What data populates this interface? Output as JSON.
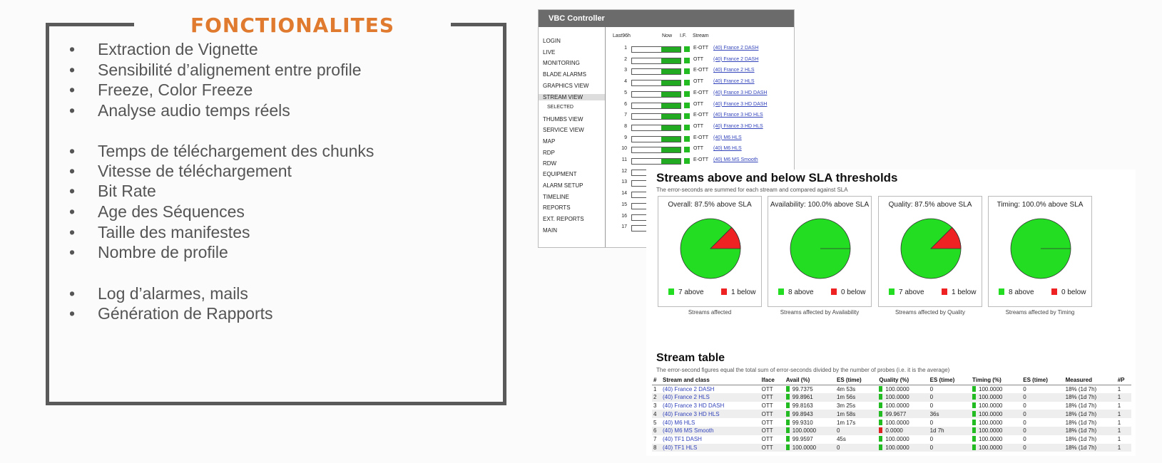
{
  "features": {
    "title": "FONCTIONALITES",
    "items": [
      "Extraction de Vignette",
      "Sensibilité d’alignement entre profile",
      " Freeze, Color Freeze",
      " Analyse audio temps réels",
      " Temps de téléchargement des chunks",
      " Vitesse de téléchargement",
      " Bit Rate",
      " Age des Séquences",
      " Taille des manifestes",
      " Nombre de profile",
      " Log d’alarmes, mails",
      " Génération de Rapports"
    ],
    "bullet": "•"
  },
  "vbc": {
    "title": "VBC Controller",
    "headers": {
      "last96h": "Last96h",
      "now": "Now",
      "if": "I.F.",
      "stream": "Stream"
    },
    "menu": [
      "LOGIN",
      "LIVE",
      "MONITORING",
      "BLADE ALARMS",
      "GRAPHICS VIEW",
      "STREAM VIEW",
      "SELECTED",
      "THUMBS VIEW",
      "SERVICE VIEW",
      "MAP",
      "RDP",
      "RDW",
      "EQUIPMENT",
      "ALARM SETUP",
      "TIMELINE",
      "REPORTS",
      "EXT. REPORTS",
      "MAIN"
    ],
    "rows": [
      {
        "n": "1",
        "if": "E-OTT",
        "stream": "(40) France 2 DASH"
      },
      {
        "n": "2",
        "if": "OTT",
        "stream": "(40) France 2 DASH"
      },
      {
        "n": "3",
        "if": "E-OTT",
        "stream": "(40) France 2 HLS"
      },
      {
        "n": "4",
        "if": "OTT",
        "stream": "(40) France 2 HLS"
      },
      {
        "n": "5",
        "if": "E-OTT",
        "stream": "(40) France 3 HD DASH"
      },
      {
        "n": "6",
        "if": "OTT",
        "stream": "(40) France 3 HD DASH"
      },
      {
        "n": "7",
        "if": "E-OTT",
        "stream": "(40) France 3 HD HLS"
      },
      {
        "n": "8",
        "if": "OTT",
        "stream": "(40) France 3 HD HLS"
      },
      {
        "n": "9",
        "if": "E-OTT",
        "stream": "(40) M6 HLS"
      },
      {
        "n": "10",
        "if": "OTT",
        "stream": "(40) M6 HLS"
      },
      {
        "n": "11",
        "if": "E-OTT",
        "stream": "(40) M6 MS Smooth"
      },
      {
        "n": "12",
        "if": "",
        "stream": ""
      },
      {
        "n": "13",
        "if": "",
        "stream": ""
      },
      {
        "n": "14",
        "if": "",
        "stream": ""
      },
      {
        "n": "15",
        "if": "",
        "stream": ""
      },
      {
        "n": "16",
        "if": "",
        "stream": ""
      },
      {
        "n": "17",
        "if": "",
        "stream": ""
      }
    ]
  },
  "sla": {
    "title": "Streams above and below SLA thresholds",
    "subtitle": "The error-seconds are summed for each stream and compared against SLA",
    "colors": {
      "above": "#22dd22",
      "below": "#ee2222"
    },
    "pies": [
      {
        "title": "Overall: 87.5% above SLA",
        "above_label": "7 above",
        "below_label": "1 below",
        "above": 7,
        "below": 1,
        "caption": "Streams affected"
      },
      {
        "title": "Availability: 100.0% above SLA",
        "above_label": "8 above",
        "below_label": "0 below",
        "above": 8,
        "below": 0,
        "caption": "Streams affected by Availability"
      },
      {
        "title": "Quality: 87.5% above SLA",
        "above_label": "7 above",
        "below_label": "1 below",
        "above": 7,
        "below": 1,
        "caption": "Streams affected by Quality"
      },
      {
        "title": "Timing: 100.0% above SLA",
        "above_label": "8 above",
        "below_label": "0 below",
        "above": 8,
        "below": 0,
        "caption": "Streams affected by Timing"
      }
    ],
    "table_title": "Stream table",
    "table_subtitle": "The error-second figures equal the total sum of error-seconds divided by the number of probes (i.e. it is the average)",
    "columns": [
      "#",
      "Stream and class",
      "Iface",
      "Avail (%)",
      "ES (time)",
      "Quality (%)",
      "ES (time)",
      "Timing (%)",
      "ES (time)",
      "Measured",
      "#P"
    ],
    "rows": [
      [
        "1",
        "(40) France 2 DASH",
        "OTT",
        "99.7375",
        "4m 53s",
        "100.0000",
        "0",
        "100.0000",
        "0",
        "18% (1d 7h)",
        "1"
      ],
      [
        "2",
        "(40) France 2 HLS",
        "OTT",
        "99.8961",
        "1m 56s",
        "100.0000",
        "0",
        "100.0000",
        "0",
        "18% (1d 7h)",
        "1"
      ],
      [
        "3",
        "(40) France 3 HD DASH",
        "OTT",
        "99.8163",
        "3m 25s",
        "100.0000",
        "0",
        "100.0000",
        "0",
        "18% (1d 7h)",
        "1"
      ],
      [
        "4",
        "(40) France 3 HD HLS",
        "OTT",
        "99.8943",
        "1m 58s",
        "99.9677",
        "36s",
        "100.0000",
        "0",
        "18% (1d 7h)",
        "1"
      ],
      [
        "5",
        "(40) M6 HLS",
        "OTT",
        "99.9310",
        "1m 17s",
        "100.0000",
        "0",
        "100.0000",
        "0",
        "18% (1d 7h)",
        "1"
      ],
      [
        "6",
        "(40) M6 MS Smooth",
        "OTT",
        "100.0000",
        "0",
        "0.0000",
        "1d 7h",
        "100.0000",
        "0",
        "18% (1d 7h)",
        "1"
      ],
      [
        "7",
        "(40) TF1 DASH",
        "OTT",
        "99.9597",
        "45s",
        "100.0000",
        "0",
        "100.0000",
        "0",
        "18% (1d 7h)",
        "1"
      ],
      [
        "8",
        "(40) TF1 HLS",
        "OTT",
        "100.0000",
        "0",
        "100.0000",
        "0",
        "100.0000",
        "0",
        "18% (1d 7h)",
        "1"
      ]
    ]
  }
}
